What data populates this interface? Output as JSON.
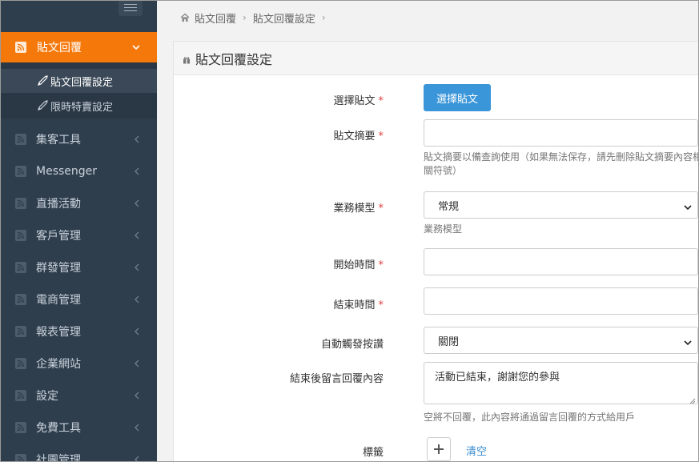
{
  "sidebar": {
    "active": {
      "label": "貼文回覆"
    },
    "submenu": [
      {
        "label": "貼文回覆設定"
      },
      {
        "label": "限時特賣設定"
      }
    ],
    "items": [
      {
        "label": "集客工具"
      },
      {
        "label": "Messenger"
      },
      {
        "label": "直播活動"
      },
      {
        "label": "客戶管理"
      },
      {
        "label": "群發管理"
      },
      {
        "label": "電商管理"
      },
      {
        "label": "報表管理"
      },
      {
        "label": "企業網站"
      },
      {
        "label": "設定"
      },
      {
        "label": "免費工具"
      },
      {
        "label": "社團管理"
      }
    ],
    "colors": {
      "background": "#2f3e4d",
      "active": "#f5780a"
    }
  },
  "breadcrumb": [
    "貼文回覆",
    "貼文回覆設定"
  ],
  "panel": {
    "title": "貼文回覆設定"
  },
  "form": {
    "post": {
      "label": "選擇貼文",
      "button": "選擇貼文"
    },
    "summary": {
      "label": "貼文摘要",
      "value": "",
      "help": "貼文摘要以備查詢使用（如果無法保存，請先刪除貼文摘要內容相關符號）"
    },
    "business_model": {
      "label": "業務模型",
      "selected": "常規",
      "help": "業務模型"
    },
    "start_time": {
      "label": "開始時間",
      "value": ""
    },
    "end_time": {
      "label": "結束時間",
      "value": ""
    },
    "auto_like": {
      "label": "自動觸發按讚",
      "selected": "關閉"
    },
    "end_reply": {
      "label": "結束後留言回覆內容",
      "value": "活動已結束，謝謝您的參與",
      "help": "空將不回覆，此內容將通過留言回覆的方式給用戶"
    },
    "tags": {
      "label": "標籤",
      "clear": "清空"
    },
    "required_mark": "*"
  },
  "colors": {
    "primary": "#3a95d9",
    "required": "#e04040"
  }
}
